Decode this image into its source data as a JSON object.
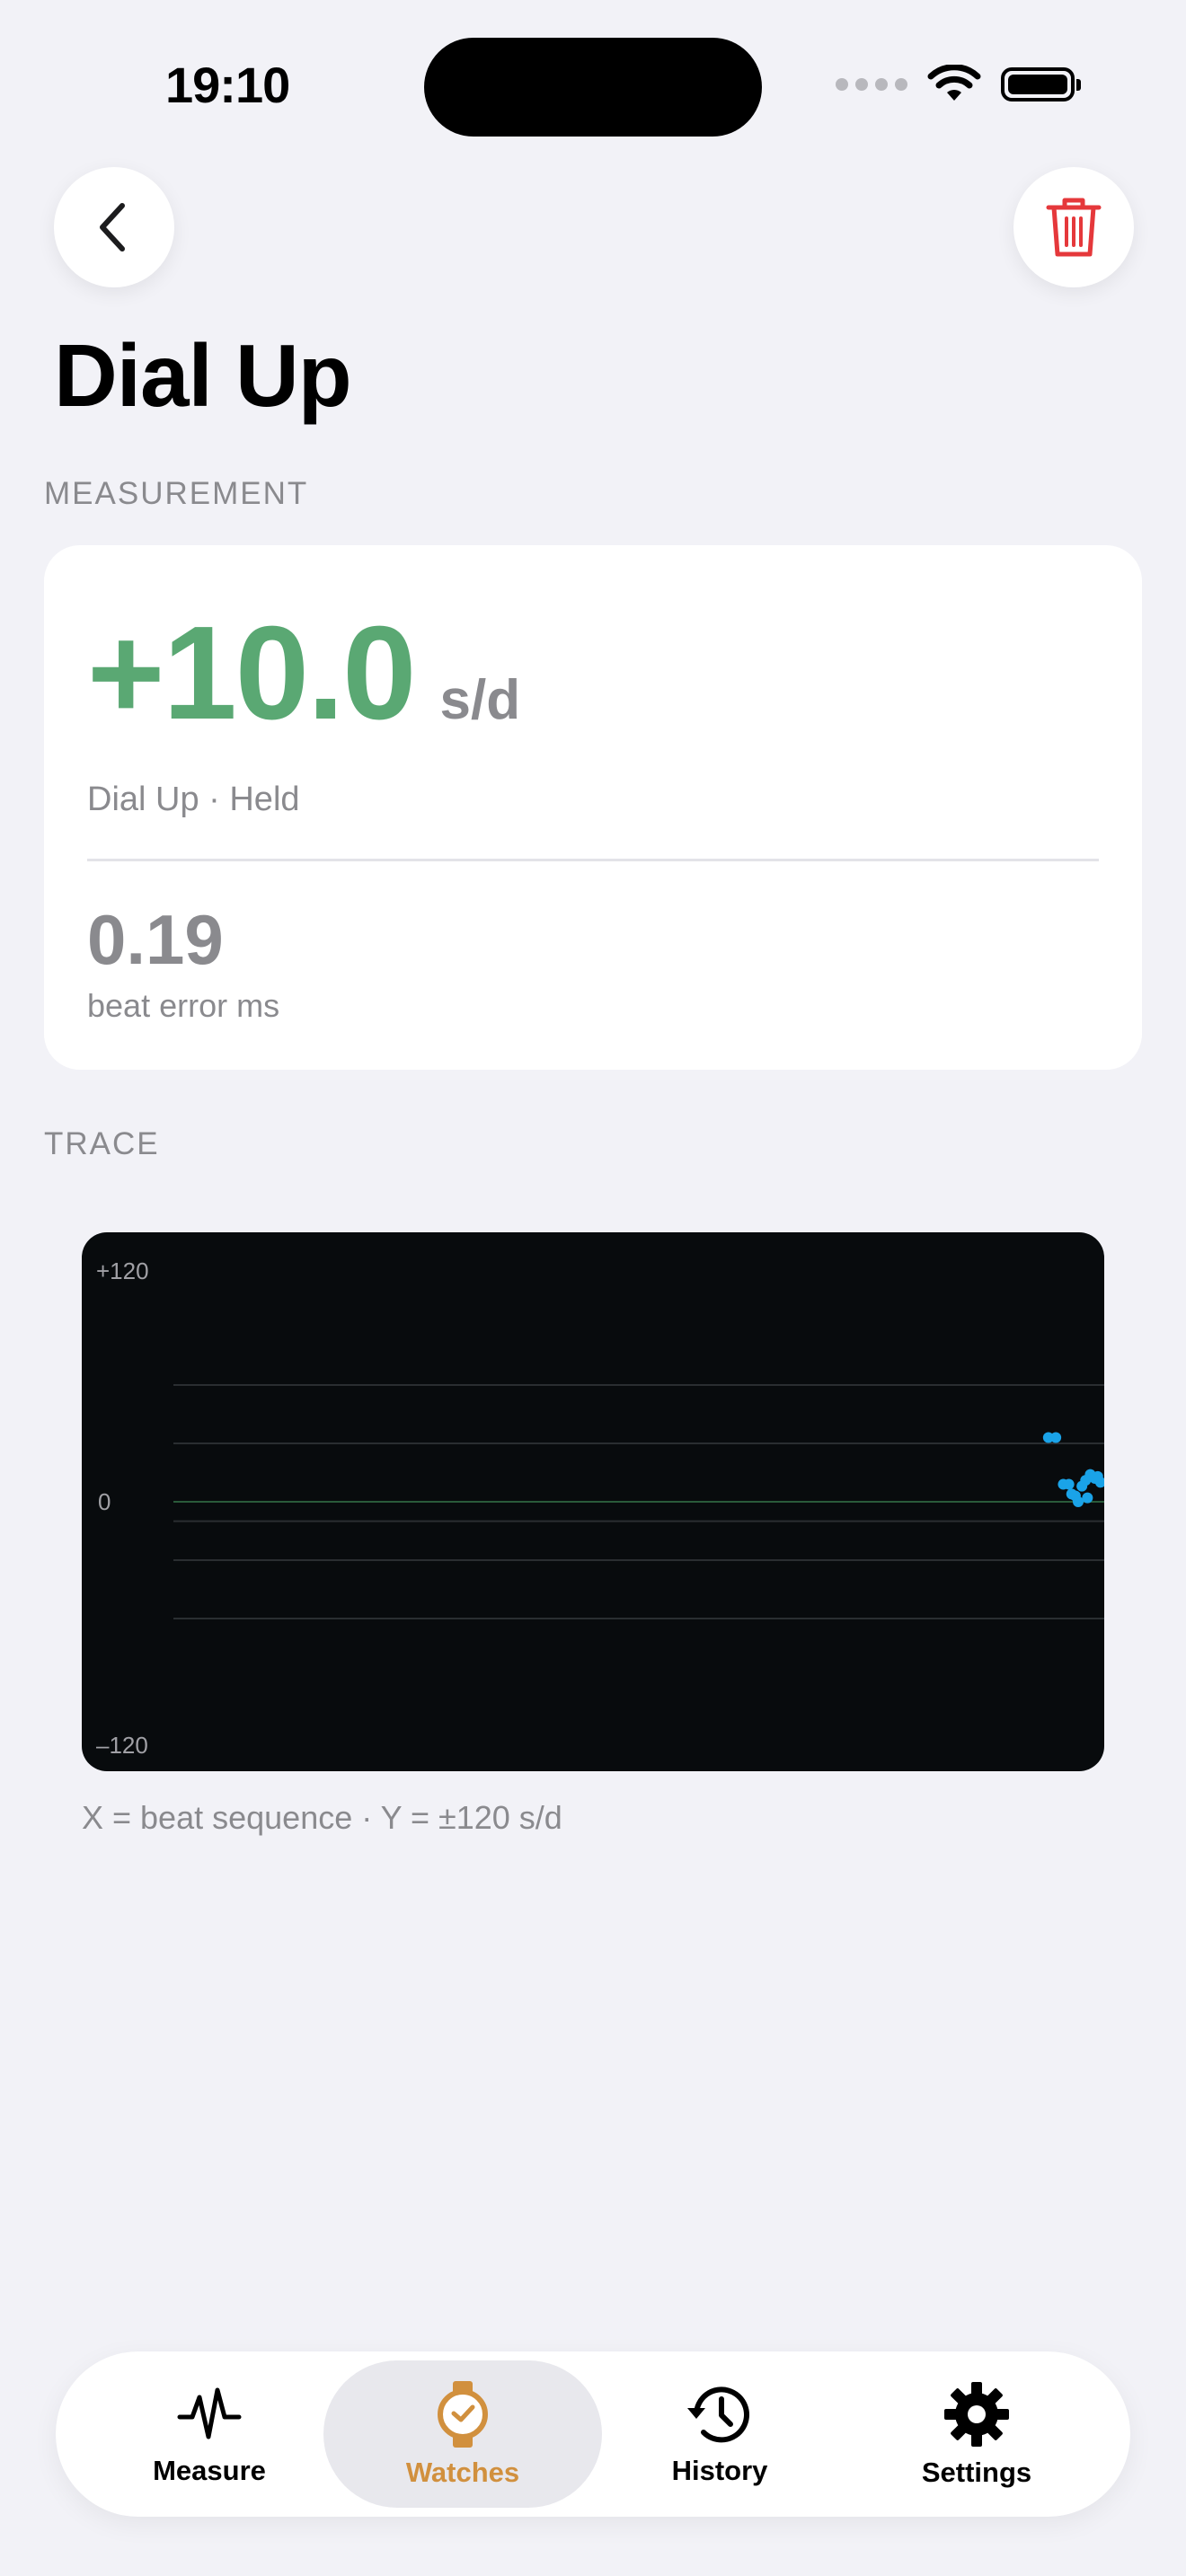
{
  "status_bar": {
    "time": "19:10"
  },
  "nav": {
    "back_icon": "chevron-left-icon",
    "delete_icon": "trash-icon",
    "delete_color": "#e5383b"
  },
  "page": {
    "title": "Dial Up"
  },
  "measurement": {
    "section_label": "MEASUREMENT",
    "rate_value": "+10.0",
    "rate_unit": "s/d",
    "rate_color": "#5aa873",
    "position_text": "Dial Up · Held",
    "beat_error_value": "0.19",
    "beat_error_label": "beat error ms"
  },
  "trace": {
    "section_label": "TRACE",
    "caption": "X = beat sequence · Y = ±120 s/d"
  },
  "chart_data": {
    "type": "scatter",
    "title": "",
    "xlabel": "",
    "ylabel": "",
    "y_tick_labels": [
      "+120",
      "0",
      "–120"
    ],
    "ylim": [
      -120,
      120
    ],
    "xlim": [
      0,
      100
    ],
    "grid": true,
    "series": [
      {
        "color": "#1aa3e8",
        "x": [
          94.0,
          94.8,
          95.6,
          96.2,
          96.9,
          97.6,
          98.0,
          98.5,
          99.0,
          99.6,
          97.2,
          98.2,
          96.5,
          99.3
        ],
        "y": [
          33,
          33,
          9,
          9,
          3,
          8,
          11,
          14,
          12,
          10,
          0,
          2,
          4,
          13
        ]
      }
    ]
  },
  "tabbar": {
    "active_color": "#d1903e",
    "tabs": [
      {
        "label": "Measure",
        "icon": "waveform-icon"
      },
      {
        "label": "Watches",
        "icon": "watch-icon"
      },
      {
        "label": "History",
        "icon": "history-clock-icon"
      },
      {
        "label": "Settings",
        "icon": "gear-icon"
      }
    ]
  }
}
